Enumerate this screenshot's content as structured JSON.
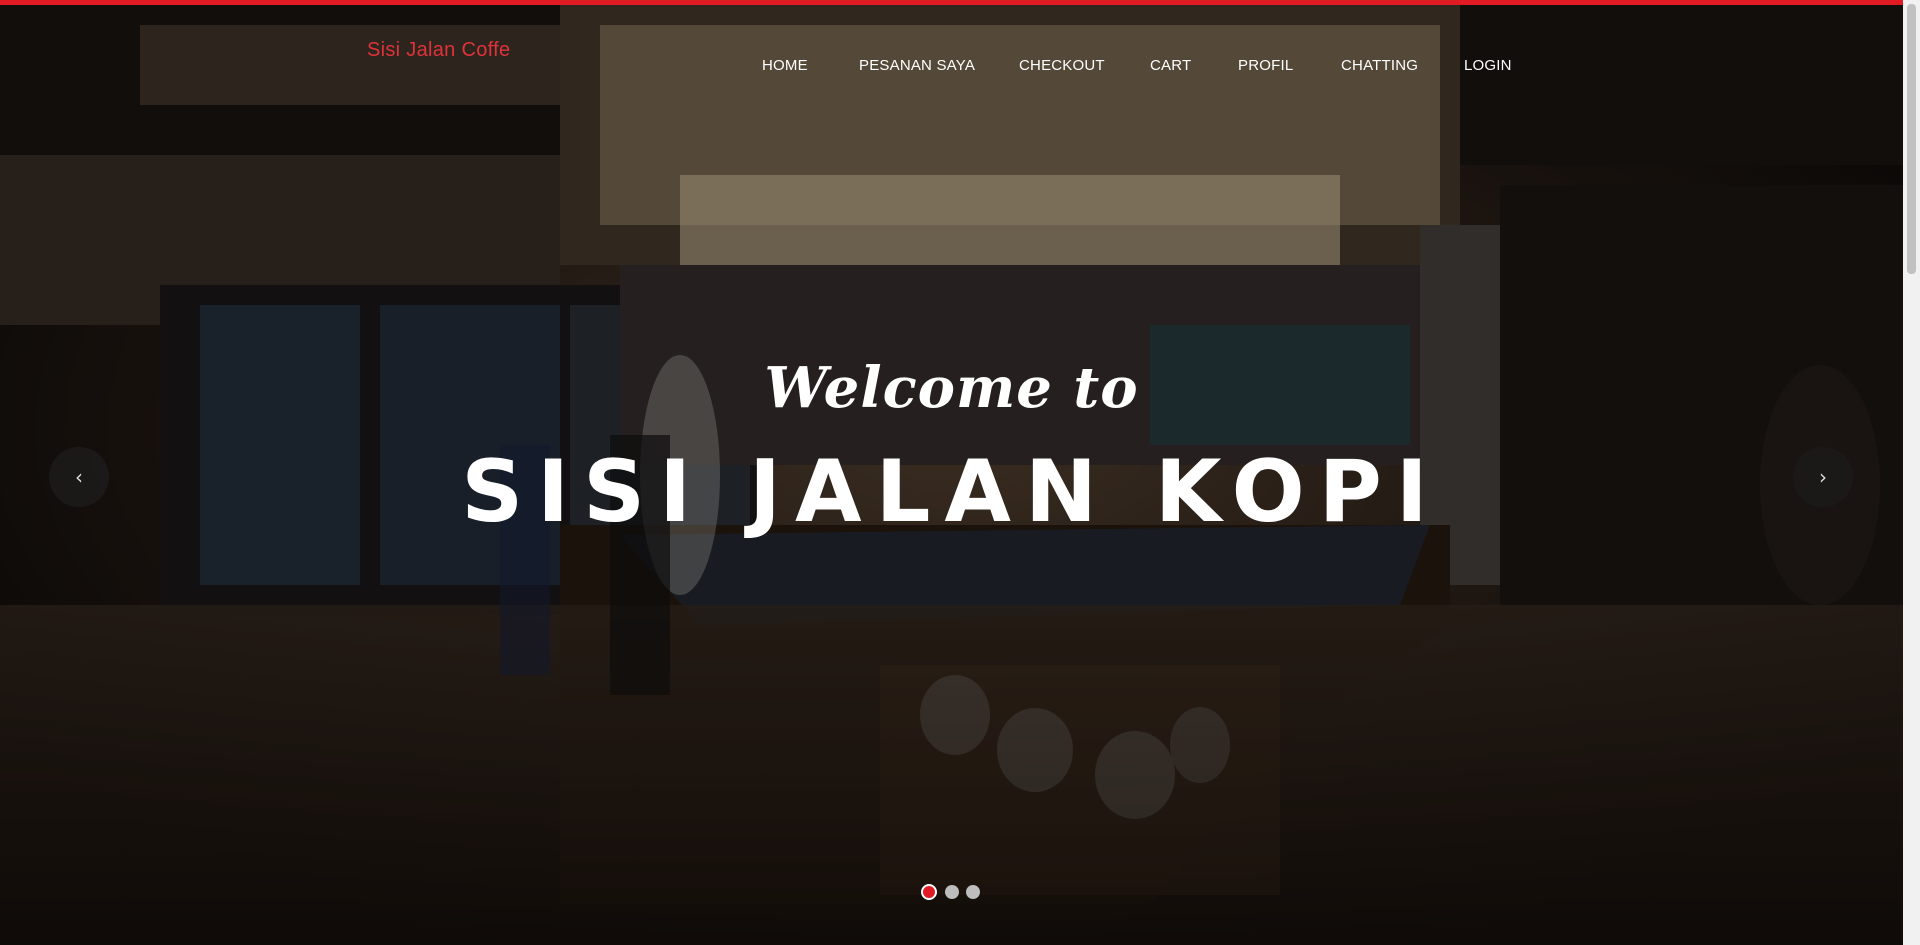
{
  "brand": "Sisi Jalan Coffe",
  "nav": {
    "items": [
      "HOME",
      "PESANAN SAYA",
      "CHECKOUT",
      "CART",
      "PROFIL",
      "CHATTING",
      "LOGIN"
    ]
  },
  "hero": {
    "welcome": "Welcome to",
    "headline": "SISI JALAN KOPI",
    "prev_icon": "‹",
    "next_icon": "›",
    "slides_count": 3,
    "active_slide": 1
  },
  "colors": {
    "accent": "#e01b24",
    "brand_text": "#e0323a",
    "nav_text": "#ffffff"
  },
  "icons": {
    "prev": "chevron-left-icon",
    "next": "chevron-right-icon"
  }
}
